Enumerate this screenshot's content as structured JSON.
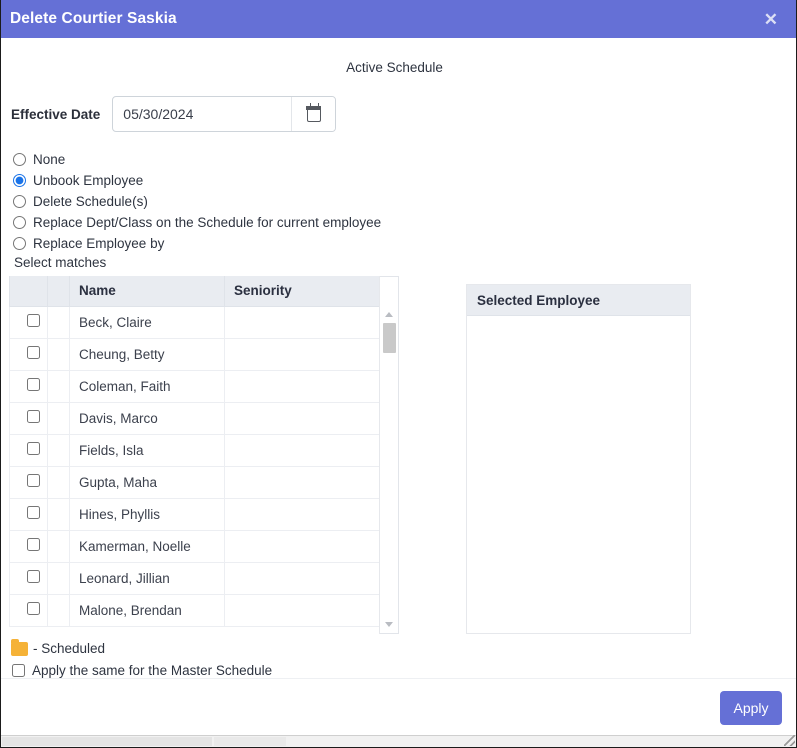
{
  "dialog": {
    "title": "Delete Courtier Saskia",
    "close_icon": "close-icon",
    "section_title": "Active Schedule"
  },
  "effective_date": {
    "label": "Effective Date",
    "value": "05/30/2024",
    "picker_icon": "calendar-icon"
  },
  "action_options": [
    {
      "label": "None",
      "selected": false
    },
    {
      "label": "Unbook Employee",
      "selected": true
    },
    {
      "label": "Delete Schedule(s)",
      "selected": false
    },
    {
      "label": "Replace Dept/Class on the Schedule for current employee",
      "selected": false
    },
    {
      "label": "Replace Employee by",
      "selected": false
    }
  ],
  "select_matches_label": "Select matches",
  "employee_table": {
    "columns": [
      "",
      "",
      "Name",
      "Seniority"
    ],
    "rows": [
      {
        "checked": false,
        "name": "Beck, Claire",
        "seniority": ""
      },
      {
        "checked": false,
        "name": "Cheung, Betty",
        "seniority": ""
      },
      {
        "checked": false,
        "name": "Coleman, Faith",
        "seniority": ""
      },
      {
        "checked": false,
        "name": "Davis, Marco",
        "seniority": ""
      },
      {
        "checked": false,
        "name": "Fields, Isla",
        "seniority": ""
      },
      {
        "checked": false,
        "name": "Gupta, Maha",
        "seniority": ""
      },
      {
        "checked": false,
        "name": "Hines, Phyllis",
        "seniority": ""
      },
      {
        "checked": false,
        "name": "Kamerman, Noelle",
        "seniority": ""
      },
      {
        "checked": false,
        "name": "Leonard, Jillian",
        "seniority": ""
      },
      {
        "checked": false,
        "name": "Malone, Brendan",
        "seniority": ""
      }
    ]
  },
  "selected_employee": {
    "header": "Selected Employee",
    "items": []
  },
  "legend": {
    "swatch_color": "#f5b237",
    "text": "- Scheduled"
  },
  "master_schedule": {
    "label": "Apply the same for the Master Schedule",
    "checked": false
  },
  "footer": {
    "apply_label": "Apply"
  },
  "colors": {
    "header_purple": "#6570d6",
    "accent_blue": "#1a73e8",
    "grid_header": "#e9ecf1"
  }
}
